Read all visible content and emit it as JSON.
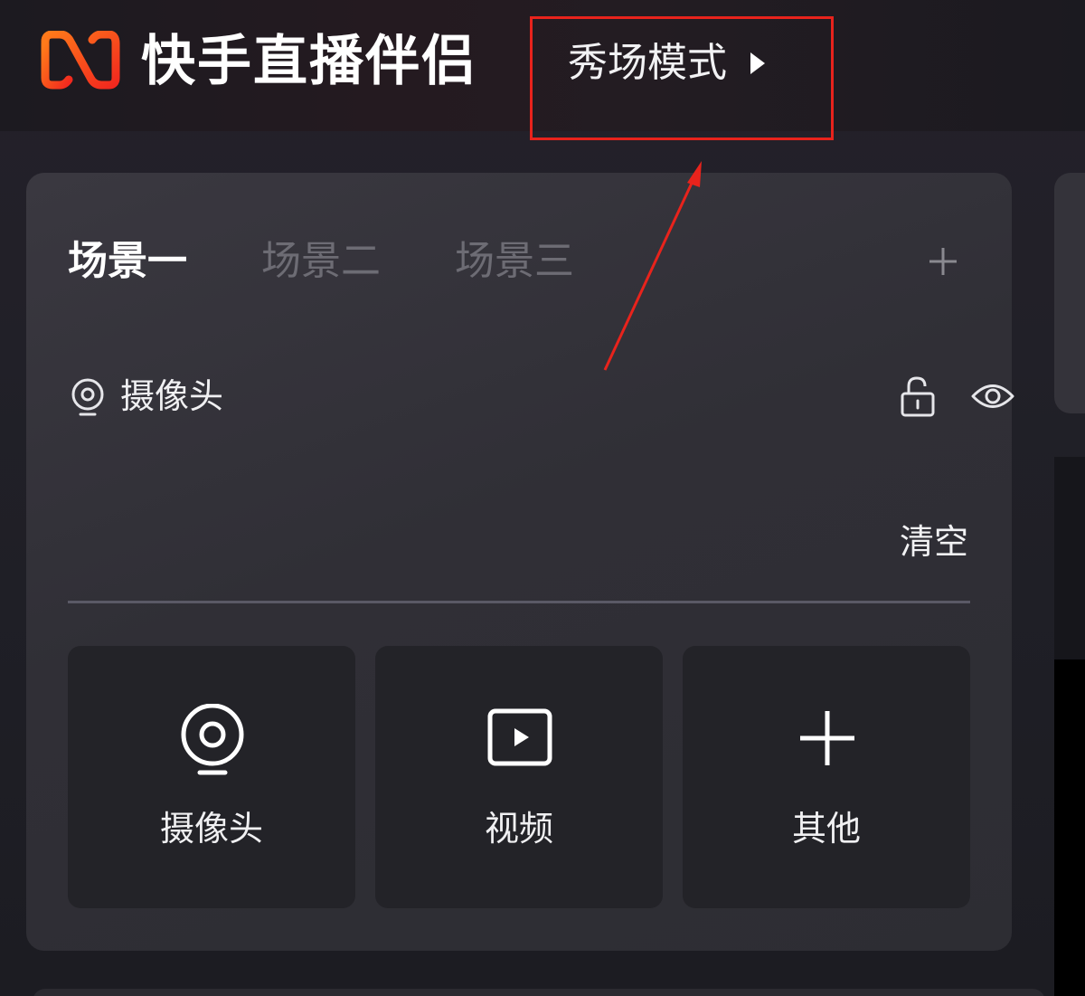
{
  "header": {
    "logo_name": "kuaishou-logo",
    "app_title": "快手直播伴侣",
    "mode_label": "秀场模式"
  },
  "annotation": {
    "highlight_color": "#e8231c"
  },
  "scenes": {
    "tabs": [
      {
        "label": "场景一",
        "active": true
      },
      {
        "label": "场景二",
        "active": false
      },
      {
        "label": "场景三",
        "active": false
      }
    ],
    "add_icon": "plus-icon"
  },
  "source_list": {
    "items": [
      {
        "label": "摄像头",
        "icon": "camera-icon",
        "lock_icon": "unlock-icon",
        "visibility_icon": "eye-icon"
      }
    ],
    "clear_label": "清空"
  },
  "add_source": {
    "cards": [
      {
        "label": "摄像头",
        "icon": "camera-icon"
      },
      {
        "label": "视频",
        "icon": "video-play-icon"
      },
      {
        "label": "其他",
        "icon": "plus-icon"
      }
    ]
  },
  "colors": {
    "accent_red": "#e8231c",
    "logo_orange": "#ff5a1f",
    "text_primary": "#ffffff",
    "text_inactive": "#6d6c74"
  }
}
